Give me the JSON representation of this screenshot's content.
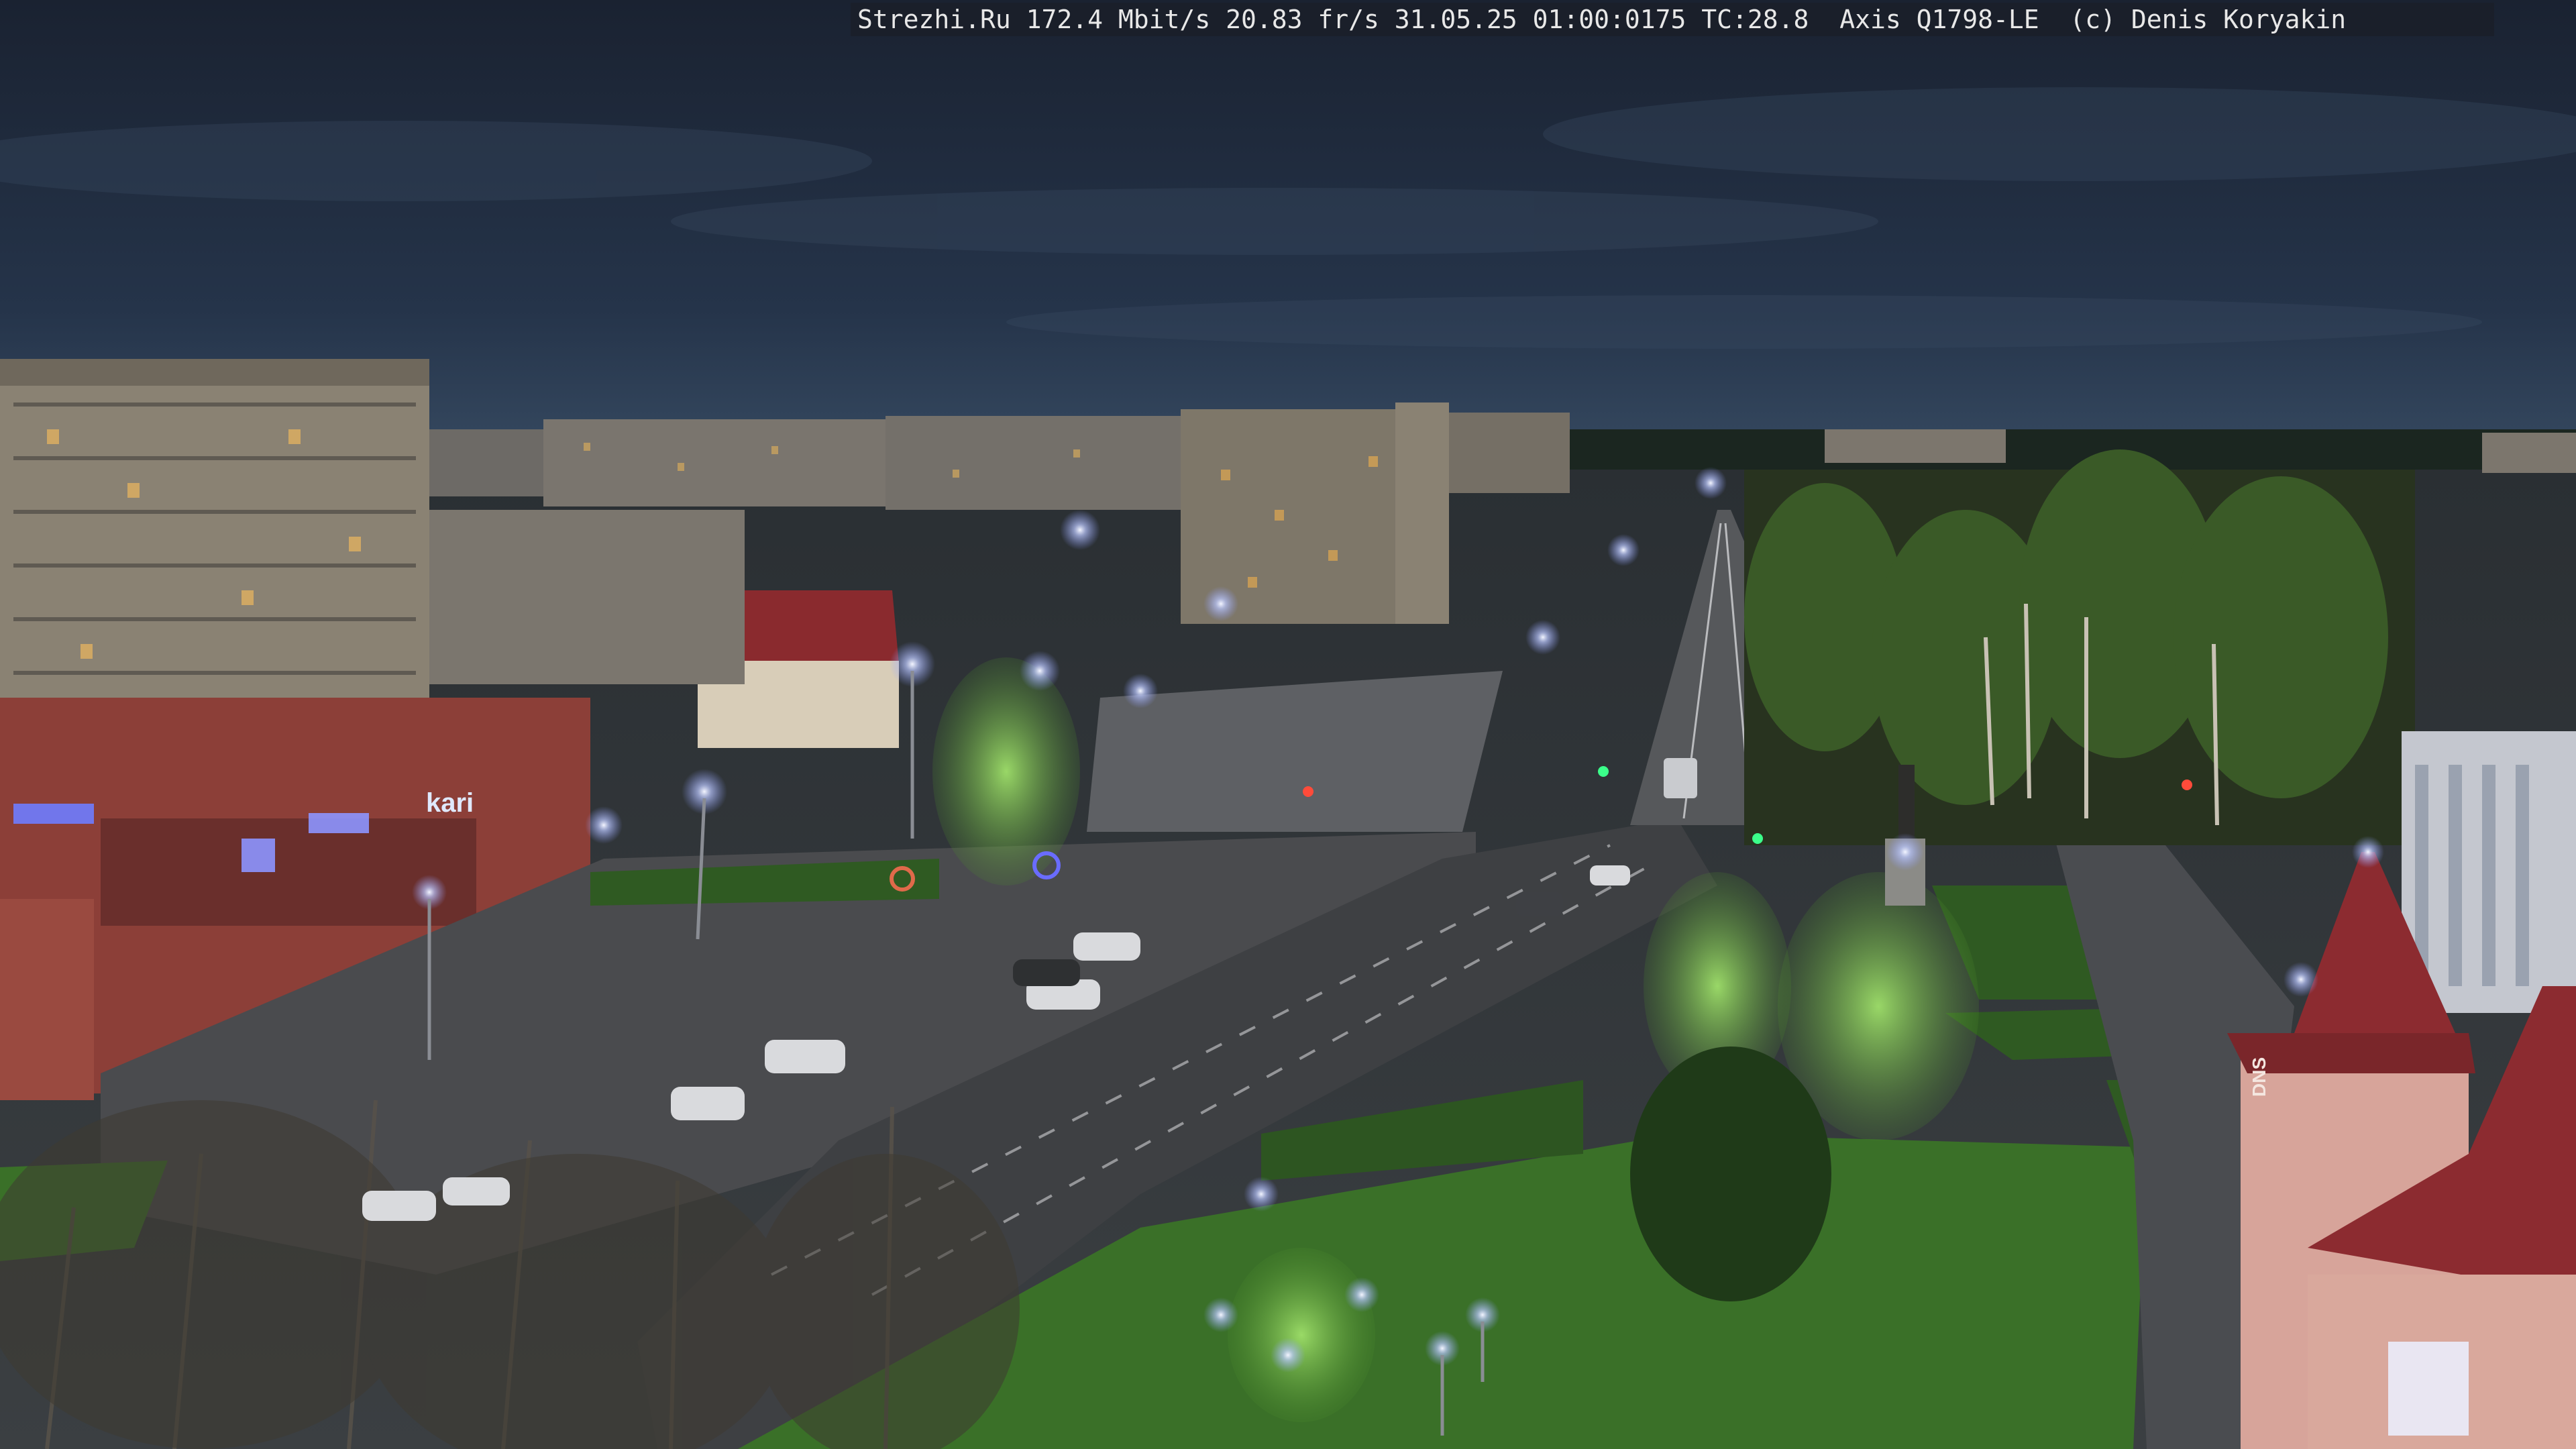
{
  "overlay": {
    "text": "Strezhi.Ru 172.4 Mbit/s 20.83 fr/s 31.05.25 01:00:0175 TC:28.8  Axis Q1798-LE  (c) Denis Koryakin"
  },
  "signs": {
    "store": "kari",
    "dns": "DNS"
  },
  "colors": {
    "sky_top": "#1b2434",
    "sky_horizon": "#2f4258",
    "grass": "#3d7a2e",
    "asphalt": "#4a4d52",
    "street_light": "#cfd8ff"
  }
}
